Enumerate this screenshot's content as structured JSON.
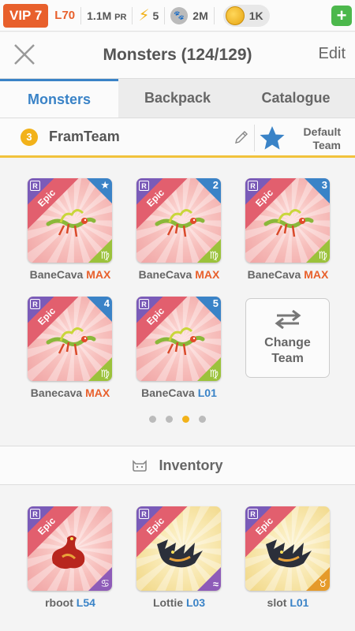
{
  "status": {
    "vip": "VIP 7",
    "level": "L70",
    "power": "1.1M",
    "power_unit": "PR",
    "energy": "5",
    "food": "2M",
    "gold": "1K",
    "plus": "+"
  },
  "header": {
    "title": "Monsters (124/129)",
    "edit": "Edit"
  },
  "tabs": [
    {
      "label": "Monsters",
      "active": true
    },
    {
      "label": "Backpack",
      "active": false
    },
    {
      "label": "Catalogue",
      "active": false
    }
  ],
  "team": {
    "number": "3",
    "name": "FramTeam",
    "default_label_1": "Default",
    "default_label_2": "Team"
  },
  "team_slots": [
    {
      "name": "BaneCava",
      "level": "MAX",
      "rarity": "Epic",
      "grade": "R",
      "badge": "★",
      "element": "♍"
    },
    {
      "name": "BaneCava",
      "level": "MAX",
      "rarity": "Epic",
      "grade": "R",
      "badge": "2",
      "element": "♍"
    },
    {
      "name": "BaneCava",
      "level": "MAX",
      "rarity": "Epic",
      "grade": "R",
      "badge": "3",
      "element": "♍"
    },
    {
      "name": "Banecava",
      "level": "MAX",
      "rarity": "Epic",
      "grade": "R",
      "badge": "4",
      "element": "♍"
    },
    {
      "name": "BaneCava",
      "level": "L01",
      "rarity": "Epic",
      "grade": "R",
      "badge": "5",
      "element": "♍"
    }
  ],
  "change_team": {
    "line1": "Change",
    "line2": "Team"
  },
  "pager": {
    "pages": 4,
    "current": 3
  },
  "inventory": {
    "title": "Inventory",
    "items": [
      {
        "name": "rboot",
        "level": "L54",
        "rarity": "Epic",
        "grade": "R",
        "element": "♋"
      },
      {
        "name": "Lottie",
        "level": "L03",
        "rarity": "Epic",
        "grade": "R",
        "element": "≈"
      },
      {
        "name": "slot",
        "level": "L01",
        "rarity": "Epic",
        "grade": "R",
        "element": "♉"
      }
    ]
  },
  "colors": {
    "accent": "#3a83c7",
    "orange": "#e8602c",
    "gold": "#f2b21a",
    "epic_ribbon": "#e25f6e"
  }
}
